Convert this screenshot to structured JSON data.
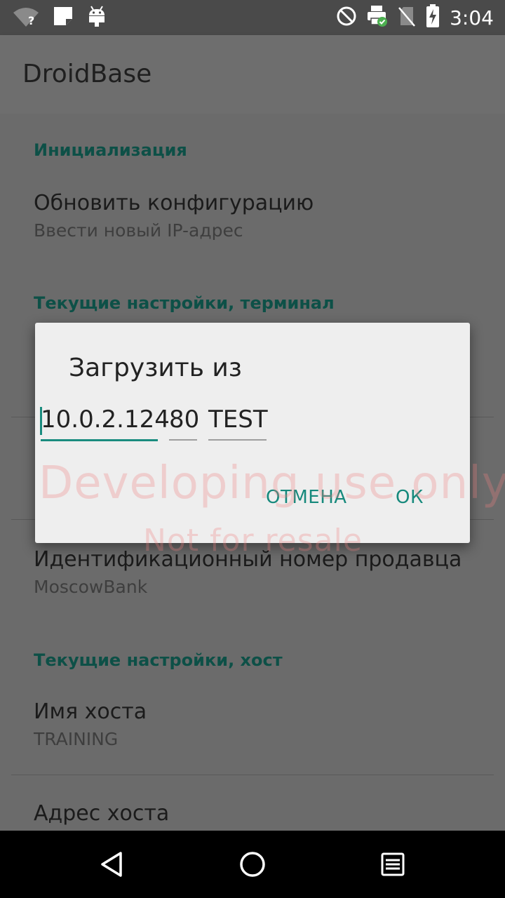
{
  "status_bar": {
    "time": "3:04",
    "wifi_badge": "?",
    "left_icons": [
      "wifi-unknown-icon",
      "notification-square-icon",
      "android-debug-icon"
    ],
    "right_icons": [
      "do-not-disturb-icon",
      "printer-check-icon",
      "no-sim-icon",
      "battery-charging-icon"
    ]
  },
  "app_bar": {
    "title": "DroidBase"
  },
  "preferences": {
    "category_init": "Инициализация",
    "update_config_title": "Обновить конфигурацию",
    "update_config_summary": "Ввести новый IP-адрес",
    "category_terminal": "Текущие настройки, терминал",
    "merchant_id_title": "Идентификационный номер продавца",
    "merchant_id_value": "MoscowBank",
    "category_host": "Текущие настройки, хост",
    "host_name_title": "Имя хоста",
    "host_name_value": "TRAINING",
    "host_address_title": "Адрес хоста"
  },
  "dialog": {
    "title": "Загрузить из",
    "ip_value": "10.0.2.124",
    "port_value": "80",
    "name_value": "TEST",
    "cancel_label": "ОТМЕНА",
    "ok_label": "ОК"
  },
  "watermark": {
    "line1": "Developing use only",
    "line2": "Not for resale"
  },
  "colors": {
    "accent": "#16897c",
    "category_text": "#0d5047",
    "scrim_background": "#6b6b6b",
    "dialog_background": "#eeeeee"
  }
}
